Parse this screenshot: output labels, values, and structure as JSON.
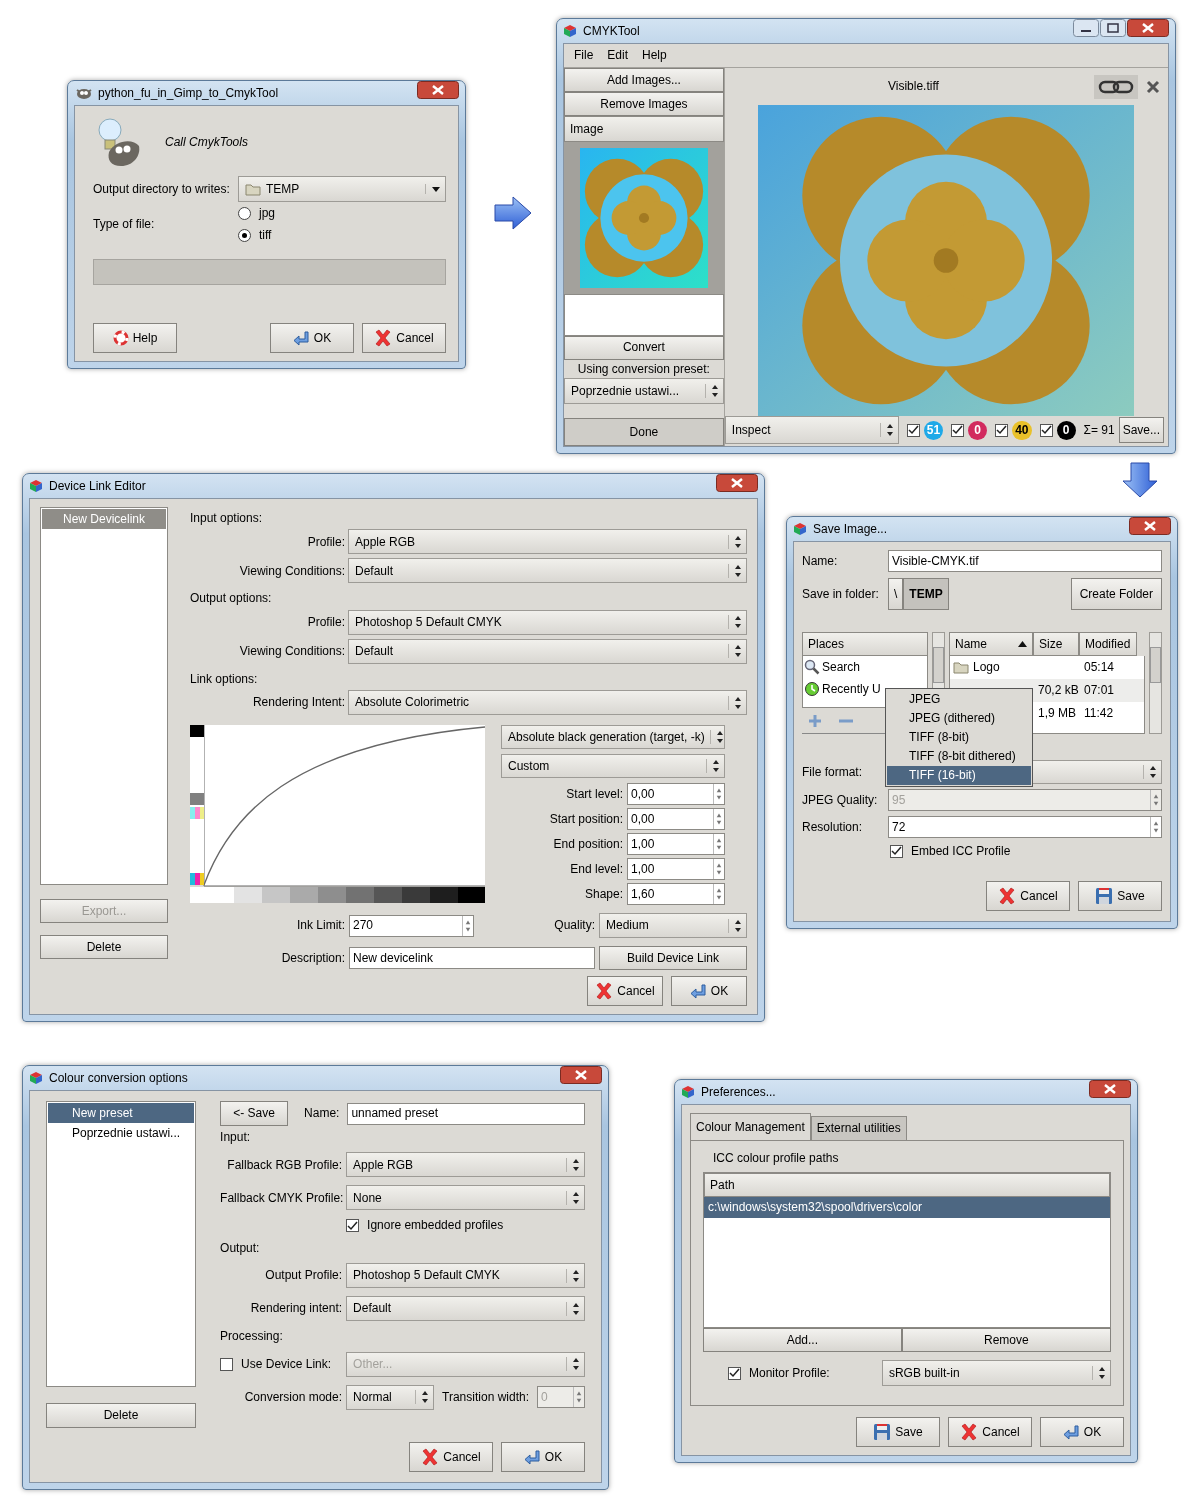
{
  "python_fu_dialog": {
    "title": "python_fu_in_Gimp_to_CmykTool",
    "heading": "Call CmykTools",
    "output_label": "Output directory to writes:",
    "output_value": "TEMP",
    "type_label": "Type of file:",
    "file_types": [
      {
        "label": "jpg",
        "selected": false
      },
      {
        "label": "tiff",
        "selected": true
      }
    ],
    "buttons": [
      {
        "label": "Help",
        "kind": "help"
      },
      {
        "label": "OK",
        "kind": "ok"
      },
      {
        "label": "Cancel",
        "kind": "cancel"
      }
    ]
  },
  "cmyktool": {
    "title": "CMYKTool",
    "menu": [
      "File",
      "Edit",
      "Help"
    ],
    "actions": [
      "Add Images...",
      "Remove Images"
    ],
    "list_header": "Image",
    "convert": "Convert",
    "preset_label": "Using conversion preset:",
    "preset_value": "Poprzednie ustawi...",
    "done": "Done",
    "image_title": "Visible.tiff",
    "inspect": "Inspect",
    "channels": [
      {
        "checked": true,
        "value": "51",
        "color": "#1fa9e8"
      },
      {
        "checked": true,
        "value": "0",
        "color": "#d22a5e"
      },
      {
        "checked": true,
        "value": "40",
        "color": "#e9c12a"
      },
      {
        "checked": true,
        "value": "0",
        "color": "#000000"
      }
    ],
    "total": "Σ= 91",
    "save": "Save..."
  },
  "device_link_editor": {
    "title": "Device Link Editor",
    "links": [
      {
        "label": "New Devicelink",
        "selected": true
      }
    ],
    "export": {
      "label": "Export...",
      "disabled": true
    },
    "delete": "Delete",
    "fields": [
      {
        "kind": "heading",
        "label": "Input options:"
      },
      {
        "kind": "select",
        "label": "Profile:",
        "value": "Apple RGB"
      },
      {
        "kind": "select",
        "label": "Viewing Conditions:",
        "value": "Default"
      },
      {
        "kind": "heading",
        "label": "Output options:"
      },
      {
        "kind": "select",
        "label": "Profile:",
        "value": "Photoshop 5 Default CMYK"
      },
      {
        "kind": "select",
        "label": "Viewing Conditions:",
        "value": "Default"
      },
      {
        "kind": "heading",
        "label": "Link options:"
      },
      {
        "kind": "select",
        "label": "Rendering Intent:",
        "value": "Absolute Colorimetric"
      }
    ],
    "generation": [
      "Absolute black generation (target, -k)",
      "Custom"
    ],
    "curve_fields": [
      {
        "label": "Start level:",
        "value": "0,00"
      },
      {
        "label": "Start position:",
        "value": "0,00"
      },
      {
        "label": "End position:",
        "value": "1,00"
      },
      {
        "label": "End level:",
        "value": "1,00"
      },
      {
        "label": "Shape:",
        "value": "1,60"
      }
    ],
    "ink_limit": {
      "label": "Ink Limit:",
      "value": "270"
    },
    "quality": {
      "label": "Quality:",
      "value": "Medium"
    },
    "description": {
      "label": "Description:",
      "value": "New devicelink"
    },
    "build": "Build Device Link",
    "buttons": [
      {
        "label": "Cancel",
        "kind": "cancel"
      },
      {
        "label": "OK",
        "kind": "ok"
      }
    ]
  },
  "save_image_dialog": {
    "title": "Save Image...",
    "name_label": "Name:",
    "name_value": "Visible-CMYK.tif",
    "folder_label": "Save in folder:",
    "path": [
      {
        "label": "\\",
        "selected": false
      },
      {
        "label": "TEMP",
        "selected": true
      }
    ],
    "create_folder": "Create Folder",
    "places_header": "Places",
    "places": [
      {
        "label": "Search",
        "kind": "search"
      },
      {
        "label": "Recently U",
        "kind": "recent"
      }
    ],
    "columns": [
      "Name",
      "Size",
      "Modified"
    ],
    "files": [
      {
        "name": "Logo",
        "modified": "05:14"
      },
      {
        "size": "70,2 kB",
        "modified": "07:01"
      },
      {
        "size": "1,9 MB",
        "modified": "11:42"
      }
    ],
    "format_label": "File format:",
    "formats": [
      {
        "label": "JPEG",
        "selected": false
      },
      {
        "label": "JPEG (dithered)",
        "selected": false
      },
      {
        "label": "TIFF (8-bit)",
        "selected": false
      },
      {
        "label": "TIFF (8-bit dithered)",
        "selected": false
      },
      {
        "label": "TIFF (16-bit)",
        "selected": true
      }
    ],
    "quality": {
      "label": "JPEG Quality:",
      "value": "95",
      "disabled": true
    },
    "resolution": {
      "label": "Resolution:",
      "value": "72",
      "disabled": false
    },
    "embed": {
      "label": "Embed ICC Profile",
      "checked": true
    },
    "buttons": [
      {
        "label": "Cancel",
        "kind": "cancel"
      },
      {
        "label": "Save",
        "kind": "save"
      }
    ]
  },
  "colour_conversion": {
    "title": "Colour conversion options",
    "presets": [
      {
        "label": "New preset",
        "selected": true
      },
      {
        "label": "Poprzednie ustawi...",
        "selected": false
      }
    ],
    "delete": "Delete",
    "save": "<- Save",
    "name_label": "Name:",
    "name_value": "unnamed preset",
    "fields": [
      {
        "kind": "heading",
        "label": "Input:"
      },
      {
        "kind": "select",
        "label": "Fallback RGB Profile:",
        "value": "Apple RGB"
      },
      {
        "kind": "select",
        "label": "Fallback CMYK Profile:",
        "value": "None"
      },
      {
        "kind": "check",
        "label": "Ignore embedded profiles",
        "checked": true
      },
      {
        "kind": "heading",
        "label": "Output:"
      },
      {
        "kind": "select",
        "label": "Output Profile:",
        "value": "Photoshop 5 Default CMYK"
      },
      {
        "kind": "select",
        "label": "Rendering intent:",
        "value": "Default"
      },
      {
        "kind": "heading",
        "label": "Processing:"
      },
      {
        "kind": "check_select",
        "label": "Use Device Link:",
        "checked": false,
        "value": "Other...",
        "disabled": true
      },
      {
        "kind": "mode",
        "label": "Conversion mode:",
        "value": "Normal",
        "width_label": "Transition width:",
        "width_value": "0",
        "disabled": true
      }
    ],
    "buttons": [
      {
        "label": "Cancel",
        "kind": "cancel"
      },
      {
        "label": "OK",
        "kind": "ok"
      }
    ]
  },
  "preferences": {
    "title": "Preferences...",
    "tabs": [
      {
        "label": "Colour Management",
        "selected": true
      },
      {
        "label": "External utilities",
        "selected": false
      }
    ],
    "section": "ICC colour profile paths",
    "column": "Path",
    "paths": [
      {
        "label": "c:\\windows\\system32\\spool\\drivers\\color",
        "selected": true
      }
    ],
    "add": "Add...",
    "remove": "Remove",
    "monitor": {
      "label": "Monitor Profile:",
      "checked": true,
      "value": "sRGB built-in"
    },
    "buttons": [
      {
        "label": "Save",
        "kind": "save"
      },
      {
        "label": "Cancel",
        "kind": "cancel"
      },
      {
        "label": "OK",
        "kind": "ok"
      }
    ]
  }
}
